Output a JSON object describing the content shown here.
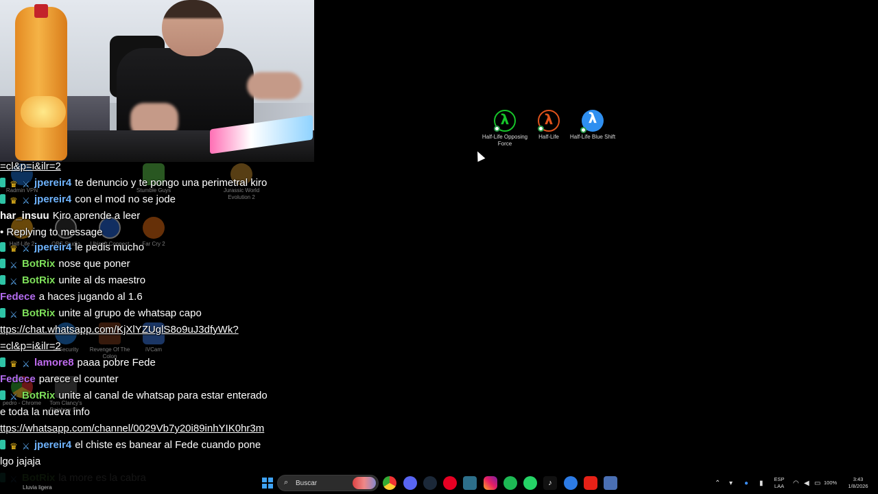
{
  "desktop_icons_right": [
    {
      "label": "Half-Life Opposing Force",
      "color": "#17c42a"
    },
    {
      "label": "Half-Life",
      "color": "#e0531c"
    },
    {
      "label": "Half-Life Blue Shift",
      "color": "#2f8ff0"
    }
  ],
  "desktop_icons_left": [
    {
      "label": "Radmin VPN"
    },
    {
      "label": "Stumble Guys"
    },
    {
      "label": "Jurassic World Evolution 2"
    },
    {
      "label": "Half-Life 2"
    },
    {
      "label": "OBS Studio"
    },
    {
      "label": "Ubisoft Connect"
    },
    {
      "label": "Far Cry 2"
    },
    {
      "label": "Revenge Of The Colon"
    },
    {
      "label": "iVCam"
    },
    {
      "label": "pedro - Chrome"
    },
    {
      "label": "Tom Clancy's Rainbow Si..."
    },
    {
      "label": "al Security"
    }
  ],
  "chat": [
    {
      "prefix": "",
      "user": "",
      "text": "=cl&p=i&ilr=2",
      "link": true
    },
    {
      "badges": [
        "sub",
        "crown",
        "sword"
      ],
      "user": "jpereir4",
      "user_color": "#6fb4ff",
      "text": "te denuncio y te pongo una perimetral kiro"
    },
    {
      "badges": [
        "sub",
        "crown",
        "sword"
      ],
      "user": "jpereir4",
      "user_color": "#6fb4ff",
      "text": "con el mod no se jode"
    },
    {
      "badges": [],
      "user": "har_insuu",
      "user_color": "#ffffff",
      "text": "Kiro aprende a leer"
    },
    {
      "badges": [],
      "user": "",
      "text": "• Replying to message"
    },
    {
      "badges": [
        "sub",
        "crown",
        "sword"
      ],
      "user": "jpereir4",
      "user_color": "#6fb4ff",
      "text": "le pedis mucho"
    },
    {
      "badges": [
        "sub",
        "sword"
      ],
      "user": "BotRix",
      "user_color": "#7ee05a",
      "text": "nose que poner"
    },
    {
      "badges": [
        "sub",
        "sword"
      ],
      "user": "BotRix",
      "user_color": "#7ee05a",
      "text": "unite al ds maestro"
    },
    {
      "badges": [],
      "user": "Fedece",
      "user_color": "#b46cf0",
      "text": "a haces jugando al 1.6"
    },
    {
      "badges": [
        "sub",
        "sword"
      ],
      "user": "BotRix",
      "user_color": "#7ee05a",
      "text": "unite al grupo de whatsap capo"
    },
    {
      "badges": [],
      "user": "",
      "text": "ttps://chat.whatsapp.com/KjXlYZUglS8o9uJ3dfyWk?",
      "link": true
    },
    {
      "badges": [],
      "user": "",
      "text": "=cl&p=i&ilr=2",
      "link": true
    },
    {
      "badges": [
        "sub",
        "crown",
        "sword"
      ],
      "user": "lamore8",
      "user_color": "#c06cf0",
      "text": "paaa pobre Fede"
    },
    {
      "badges": [],
      "user": "Fedece",
      "user_color": "#b46cf0",
      "text": "parece el counter"
    },
    {
      "badges": [
        "sub",
        "sword"
      ],
      "user": "BotRix",
      "user_color": "#7ee05a",
      "text": "unite al canal de whatsap para estar enterado"
    },
    {
      "badges": [],
      "user": "",
      "text": "e toda la nueva info"
    },
    {
      "badges": [],
      "user": "",
      "text": "ttps://whatsapp.com/channel/0029Vb7y20i89inhYIK0hr3m",
      "link": true
    },
    {
      "badges": [
        "sub",
        "crown",
        "sword"
      ],
      "user": "jpereir4",
      "user_color": "#6fb4ff",
      "text": "el chiste es banear al Fede cuando pone"
    },
    {
      "badges": [],
      "user": "",
      "text": "lgo jajaja"
    },
    {
      "badges": [
        "sub",
        "sword"
      ],
      "user": "BotRix",
      "user_color": "#7ee05a",
      "text": "la more es la cabra"
    }
  ],
  "taskbar": {
    "weather": "Lluvia ligera",
    "search_placeholder": "Buscar",
    "lang_top": "ESP",
    "lang_bottom": "LAA",
    "battery": "100%",
    "time": "3:43",
    "date": "1/8/2026"
  }
}
